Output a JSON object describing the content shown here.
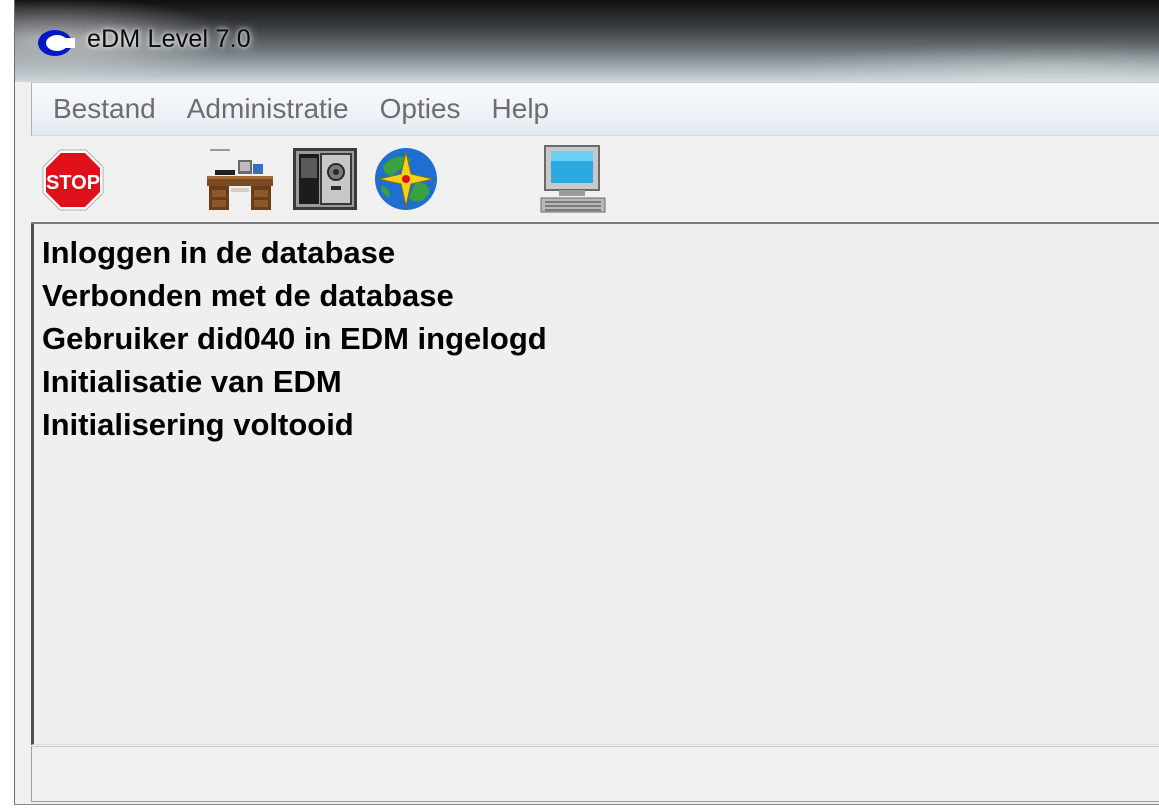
{
  "window": {
    "title": "eDM Level 7.0",
    "app_icon": "edm-app-icon"
  },
  "menu": {
    "items": [
      {
        "label": "Bestand"
      },
      {
        "label": "Administratie"
      },
      {
        "label": "Opties"
      },
      {
        "label": "Help"
      }
    ]
  },
  "toolbar": {
    "buttons": [
      {
        "icon": "stop-sign-icon",
        "label": "STOP"
      },
      {
        "icon": "desk-icon"
      },
      {
        "icon": "safe-icon"
      },
      {
        "icon": "globe-compass-icon"
      },
      {
        "icon": "computer-terminal-icon"
      }
    ]
  },
  "log": {
    "lines": [
      "Inloggen in de database",
      "Verbonden met de database",
      "Gebruiker did040 in EDM ingelogd",
      "Initialisatie van EDM",
      "Initialisering voltooid"
    ]
  },
  "status": {
    "text": ""
  },
  "colors": {
    "stop_red": "#e0101a",
    "menu_text": "#6d6d6d",
    "log_text": "#000000"
  }
}
